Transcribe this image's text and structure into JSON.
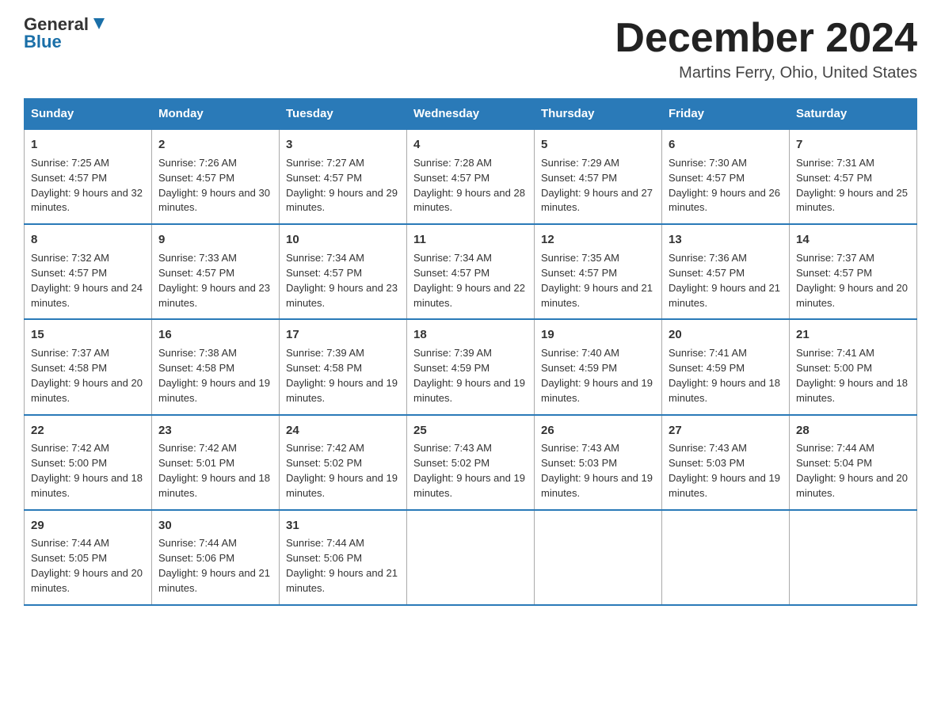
{
  "logo": {
    "text1": "General",
    "text2": "Blue"
  },
  "header": {
    "month": "December 2024",
    "location": "Martins Ferry, Ohio, United States"
  },
  "days_of_week": [
    "Sunday",
    "Monday",
    "Tuesday",
    "Wednesday",
    "Thursday",
    "Friday",
    "Saturday"
  ],
  "weeks": [
    [
      {
        "num": "1",
        "sunrise": "Sunrise: 7:25 AM",
        "sunset": "Sunset: 4:57 PM",
        "daylight": "Daylight: 9 hours and 32 minutes."
      },
      {
        "num": "2",
        "sunrise": "Sunrise: 7:26 AM",
        "sunset": "Sunset: 4:57 PM",
        "daylight": "Daylight: 9 hours and 30 minutes."
      },
      {
        "num": "3",
        "sunrise": "Sunrise: 7:27 AM",
        "sunset": "Sunset: 4:57 PM",
        "daylight": "Daylight: 9 hours and 29 minutes."
      },
      {
        "num": "4",
        "sunrise": "Sunrise: 7:28 AM",
        "sunset": "Sunset: 4:57 PM",
        "daylight": "Daylight: 9 hours and 28 minutes."
      },
      {
        "num": "5",
        "sunrise": "Sunrise: 7:29 AM",
        "sunset": "Sunset: 4:57 PM",
        "daylight": "Daylight: 9 hours and 27 minutes."
      },
      {
        "num": "6",
        "sunrise": "Sunrise: 7:30 AM",
        "sunset": "Sunset: 4:57 PM",
        "daylight": "Daylight: 9 hours and 26 minutes."
      },
      {
        "num": "7",
        "sunrise": "Sunrise: 7:31 AM",
        "sunset": "Sunset: 4:57 PM",
        "daylight": "Daylight: 9 hours and 25 minutes."
      }
    ],
    [
      {
        "num": "8",
        "sunrise": "Sunrise: 7:32 AM",
        "sunset": "Sunset: 4:57 PM",
        "daylight": "Daylight: 9 hours and 24 minutes."
      },
      {
        "num": "9",
        "sunrise": "Sunrise: 7:33 AM",
        "sunset": "Sunset: 4:57 PM",
        "daylight": "Daylight: 9 hours and 23 minutes."
      },
      {
        "num": "10",
        "sunrise": "Sunrise: 7:34 AM",
        "sunset": "Sunset: 4:57 PM",
        "daylight": "Daylight: 9 hours and 23 minutes."
      },
      {
        "num": "11",
        "sunrise": "Sunrise: 7:34 AM",
        "sunset": "Sunset: 4:57 PM",
        "daylight": "Daylight: 9 hours and 22 minutes."
      },
      {
        "num": "12",
        "sunrise": "Sunrise: 7:35 AM",
        "sunset": "Sunset: 4:57 PM",
        "daylight": "Daylight: 9 hours and 21 minutes."
      },
      {
        "num": "13",
        "sunrise": "Sunrise: 7:36 AM",
        "sunset": "Sunset: 4:57 PM",
        "daylight": "Daylight: 9 hours and 21 minutes."
      },
      {
        "num": "14",
        "sunrise": "Sunrise: 7:37 AM",
        "sunset": "Sunset: 4:57 PM",
        "daylight": "Daylight: 9 hours and 20 minutes."
      }
    ],
    [
      {
        "num": "15",
        "sunrise": "Sunrise: 7:37 AM",
        "sunset": "Sunset: 4:58 PM",
        "daylight": "Daylight: 9 hours and 20 minutes."
      },
      {
        "num": "16",
        "sunrise": "Sunrise: 7:38 AM",
        "sunset": "Sunset: 4:58 PM",
        "daylight": "Daylight: 9 hours and 19 minutes."
      },
      {
        "num": "17",
        "sunrise": "Sunrise: 7:39 AM",
        "sunset": "Sunset: 4:58 PM",
        "daylight": "Daylight: 9 hours and 19 minutes."
      },
      {
        "num": "18",
        "sunrise": "Sunrise: 7:39 AM",
        "sunset": "Sunset: 4:59 PM",
        "daylight": "Daylight: 9 hours and 19 minutes."
      },
      {
        "num": "19",
        "sunrise": "Sunrise: 7:40 AM",
        "sunset": "Sunset: 4:59 PM",
        "daylight": "Daylight: 9 hours and 19 minutes."
      },
      {
        "num": "20",
        "sunrise": "Sunrise: 7:41 AM",
        "sunset": "Sunset: 4:59 PM",
        "daylight": "Daylight: 9 hours and 18 minutes."
      },
      {
        "num": "21",
        "sunrise": "Sunrise: 7:41 AM",
        "sunset": "Sunset: 5:00 PM",
        "daylight": "Daylight: 9 hours and 18 minutes."
      }
    ],
    [
      {
        "num": "22",
        "sunrise": "Sunrise: 7:42 AM",
        "sunset": "Sunset: 5:00 PM",
        "daylight": "Daylight: 9 hours and 18 minutes."
      },
      {
        "num": "23",
        "sunrise": "Sunrise: 7:42 AM",
        "sunset": "Sunset: 5:01 PM",
        "daylight": "Daylight: 9 hours and 18 minutes."
      },
      {
        "num": "24",
        "sunrise": "Sunrise: 7:42 AM",
        "sunset": "Sunset: 5:02 PM",
        "daylight": "Daylight: 9 hours and 19 minutes."
      },
      {
        "num": "25",
        "sunrise": "Sunrise: 7:43 AM",
        "sunset": "Sunset: 5:02 PM",
        "daylight": "Daylight: 9 hours and 19 minutes."
      },
      {
        "num": "26",
        "sunrise": "Sunrise: 7:43 AM",
        "sunset": "Sunset: 5:03 PM",
        "daylight": "Daylight: 9 hours and 19 minutes."
      },
      {
        "num": "27",
        "sunrise": "Sunrise: 7:43 AM",
        "sunset": "Sunset: 5:03 PM",
        "daylight": "Daylight: 9 hours and 19 minutes."
      },
      {
        "num": "28",
        "sunrise": "Sunrise: 7:44 AM",
        "sunset": "Sunset: 5:04 PM",
        "daylight": "Daylight: 9 hours and 20 minutes."
      }
    ],
    [
      {
        "num": "29",
        "sunrise": "Sunrise: 7:44 AM",
        "sunset": "Sunset: 5:05 PM",
        "daylight": "Daylight: 9 hours and 20 minutes."
      },
      {
        "num": "30",
        "sunrise": "Sunrise: 7:44 AM",
        "sunset": "Sunset: 5:06 PM",
        "daylight": "Daylight: 9 hours and 21 minutes."
      },
      {
        "num": "31",
        "sunrise": "Sunrise: 7:44 AM",
        "sunset": "Sunset: 5:06 PM",
        "daylight": "Daylight: 9 hours and 21 minutes."
      },
      null,
      null,
      null,
      null
    ]
  ]
}
